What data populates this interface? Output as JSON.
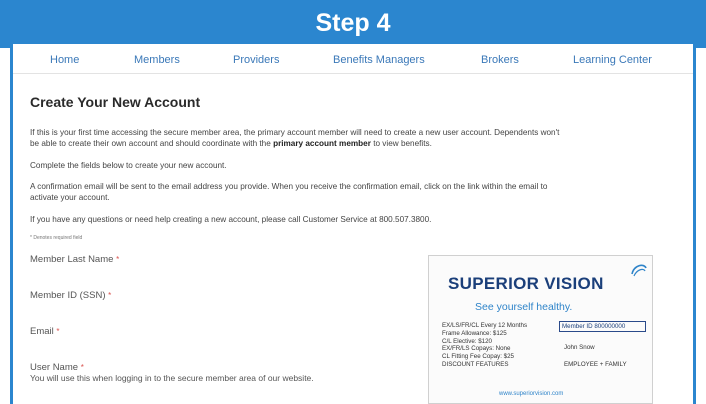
{
  "banner": {
    "title": "Step 4"
  },
  "nav": {
    "items": [
      {
        "label": "Home"
      },
      {
        "label": "Members"
      },
      {
        "label": "Providers"
      },
      {
        "label": "Benefits Managers"
      },
      {
        "label": "Brokers"
      },
      {
        "label": "Learning Center"
      }
    ]
  },
  "page": {
    "title": "Create Your New Account",
    "intro_1a": "If this is your first time accessing the secure member area, the primary account member will need to create a new user account. Dependents won't",
    "intro_1b": "be able to create their own account and should coordinate with the",
    "intro_1_bold": "primary account member",
    "intro_1c": "to view benefits.",
    "intro_2": "Complete the fields below to create your new account.",
    "intro_3a": "A confirmation email will be sent to the email address you provide. When you receive the confirmation email, click on the link within the email to",
    "intro_3b": "activate your account.",
    "intro_4": "If you have any questions or need help creating a new account, please call Customer Service at 800.507.3800.",
    "required_note": "* Denotes required field"
  },
  "form": {
    "last_name_label": "Member Last Name",
    "member_id_label": "Member ID (SSN)",
    "email_label": "Email",
    "username_label": "User Name",
    "required_mark": "*",
    "username_hint": "You will use this when logging in to the secure member area of our website."
  },
  "card": {
    "logo": "SUPERIOR VISION",
    "tagline": "See yourself healthy.",
    "benefits": [
      "EX/LS/FR/CL Every 12 Months",
      "Frame Allowance: $125",
      "C/L Elective: $120",
      "EX/FR/LS Copays: None",
      "CL Fitting Fee Copay: $25",
      "DISCOUNT FEATURES"
    ],
    "member_id": "Member ID 800000000",
    "member_name": "John Snow",
    "plan": "EMPLOYEE + FAMILY",
    "url": "www.superiorvision.com",
    "brand_color": "#1b3f7a",
    "accent_color": "#2f84c9"
  },
  "colors": {
    "banner": "#2b86cf",
    "nav_link": "#3a78b8",
    "required": "#d9534f"
  }
}
